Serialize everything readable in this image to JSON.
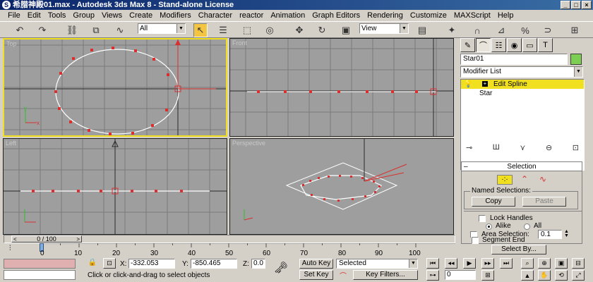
{
  "window": {
    "title": "希腊神殿01.max - Autodesk 3ds Max 8  - Stand-alone License",
    "minimize": "_",
    "maximize": "□",
    "close": "×"
  },
  "menu": [
    "File",
    "Edit",
    "Tools",
    "Group",
    "Views",
    "Create",
    "Modifiers",
    "Character",
    "reactor",
    "Animation",
    "Graph Editors",
    "Rendering",
    "Customize",
    "MAXScript",
    "Help"
  ],
  "toolbar": {
    "selection_filter": "All",
    "reference_coord": "View"
  },
  "viewports": [
    {
      "label": "Top",
      "active": true
    },
    {
      "label": "Front",
      "active": false
    },
    {
      "label": "Left",
      "active": false
    },
    {
      "label": "Perspective",
      "active": false
    }
  ],
  "panel": {
    "object_name": "Star01",
    "object_color": "#7ccf52",
    "modifier_list": "Modifier List",
    "stack": [
      {
        "label": "Edit Spline",
        "expand": "+",
        "selected": true
      },
      {
        "label": "Star",
        "selected": false
      }
    ],
    "selection": {
      "title": "Selection",
      "named_selections": "Named Selections:",
      "copy": "Copy",
      "paste": "Paste",
      "lock_handles": "Lock Handles",
      "alike": "Alike",
      "all": "All",
      "area_selection": "Area Selection:",
      "area_value": "0.1",
      "segment_end": "Segment End",
      "select_by": "Select By..."
    }
  },
  "timeline": {
    "position": "0 / 100",
    "ticks": [
      "0",
      "10",
      "20",
      "30",
      "40",
      "50",
      "60",
      "70",
      "80",
      "90",
      "100"
    ]
  },
  "status": {
    "prompt": "Click or click-and-drag to select objects",
    "x_label": "X:",
    "x_value": "-332.053",
    "y_label": "Y:",
    "y_value": "-850.465",
    "z_label": "Z:",
    "z_value": "0.0",
    "auto_key": "Auto Key",
    "set_key": "Set Key",
    "key_mode": "Selected",
    "key_filters": "Key Filters...",
    "frame": "0"
  }
}
